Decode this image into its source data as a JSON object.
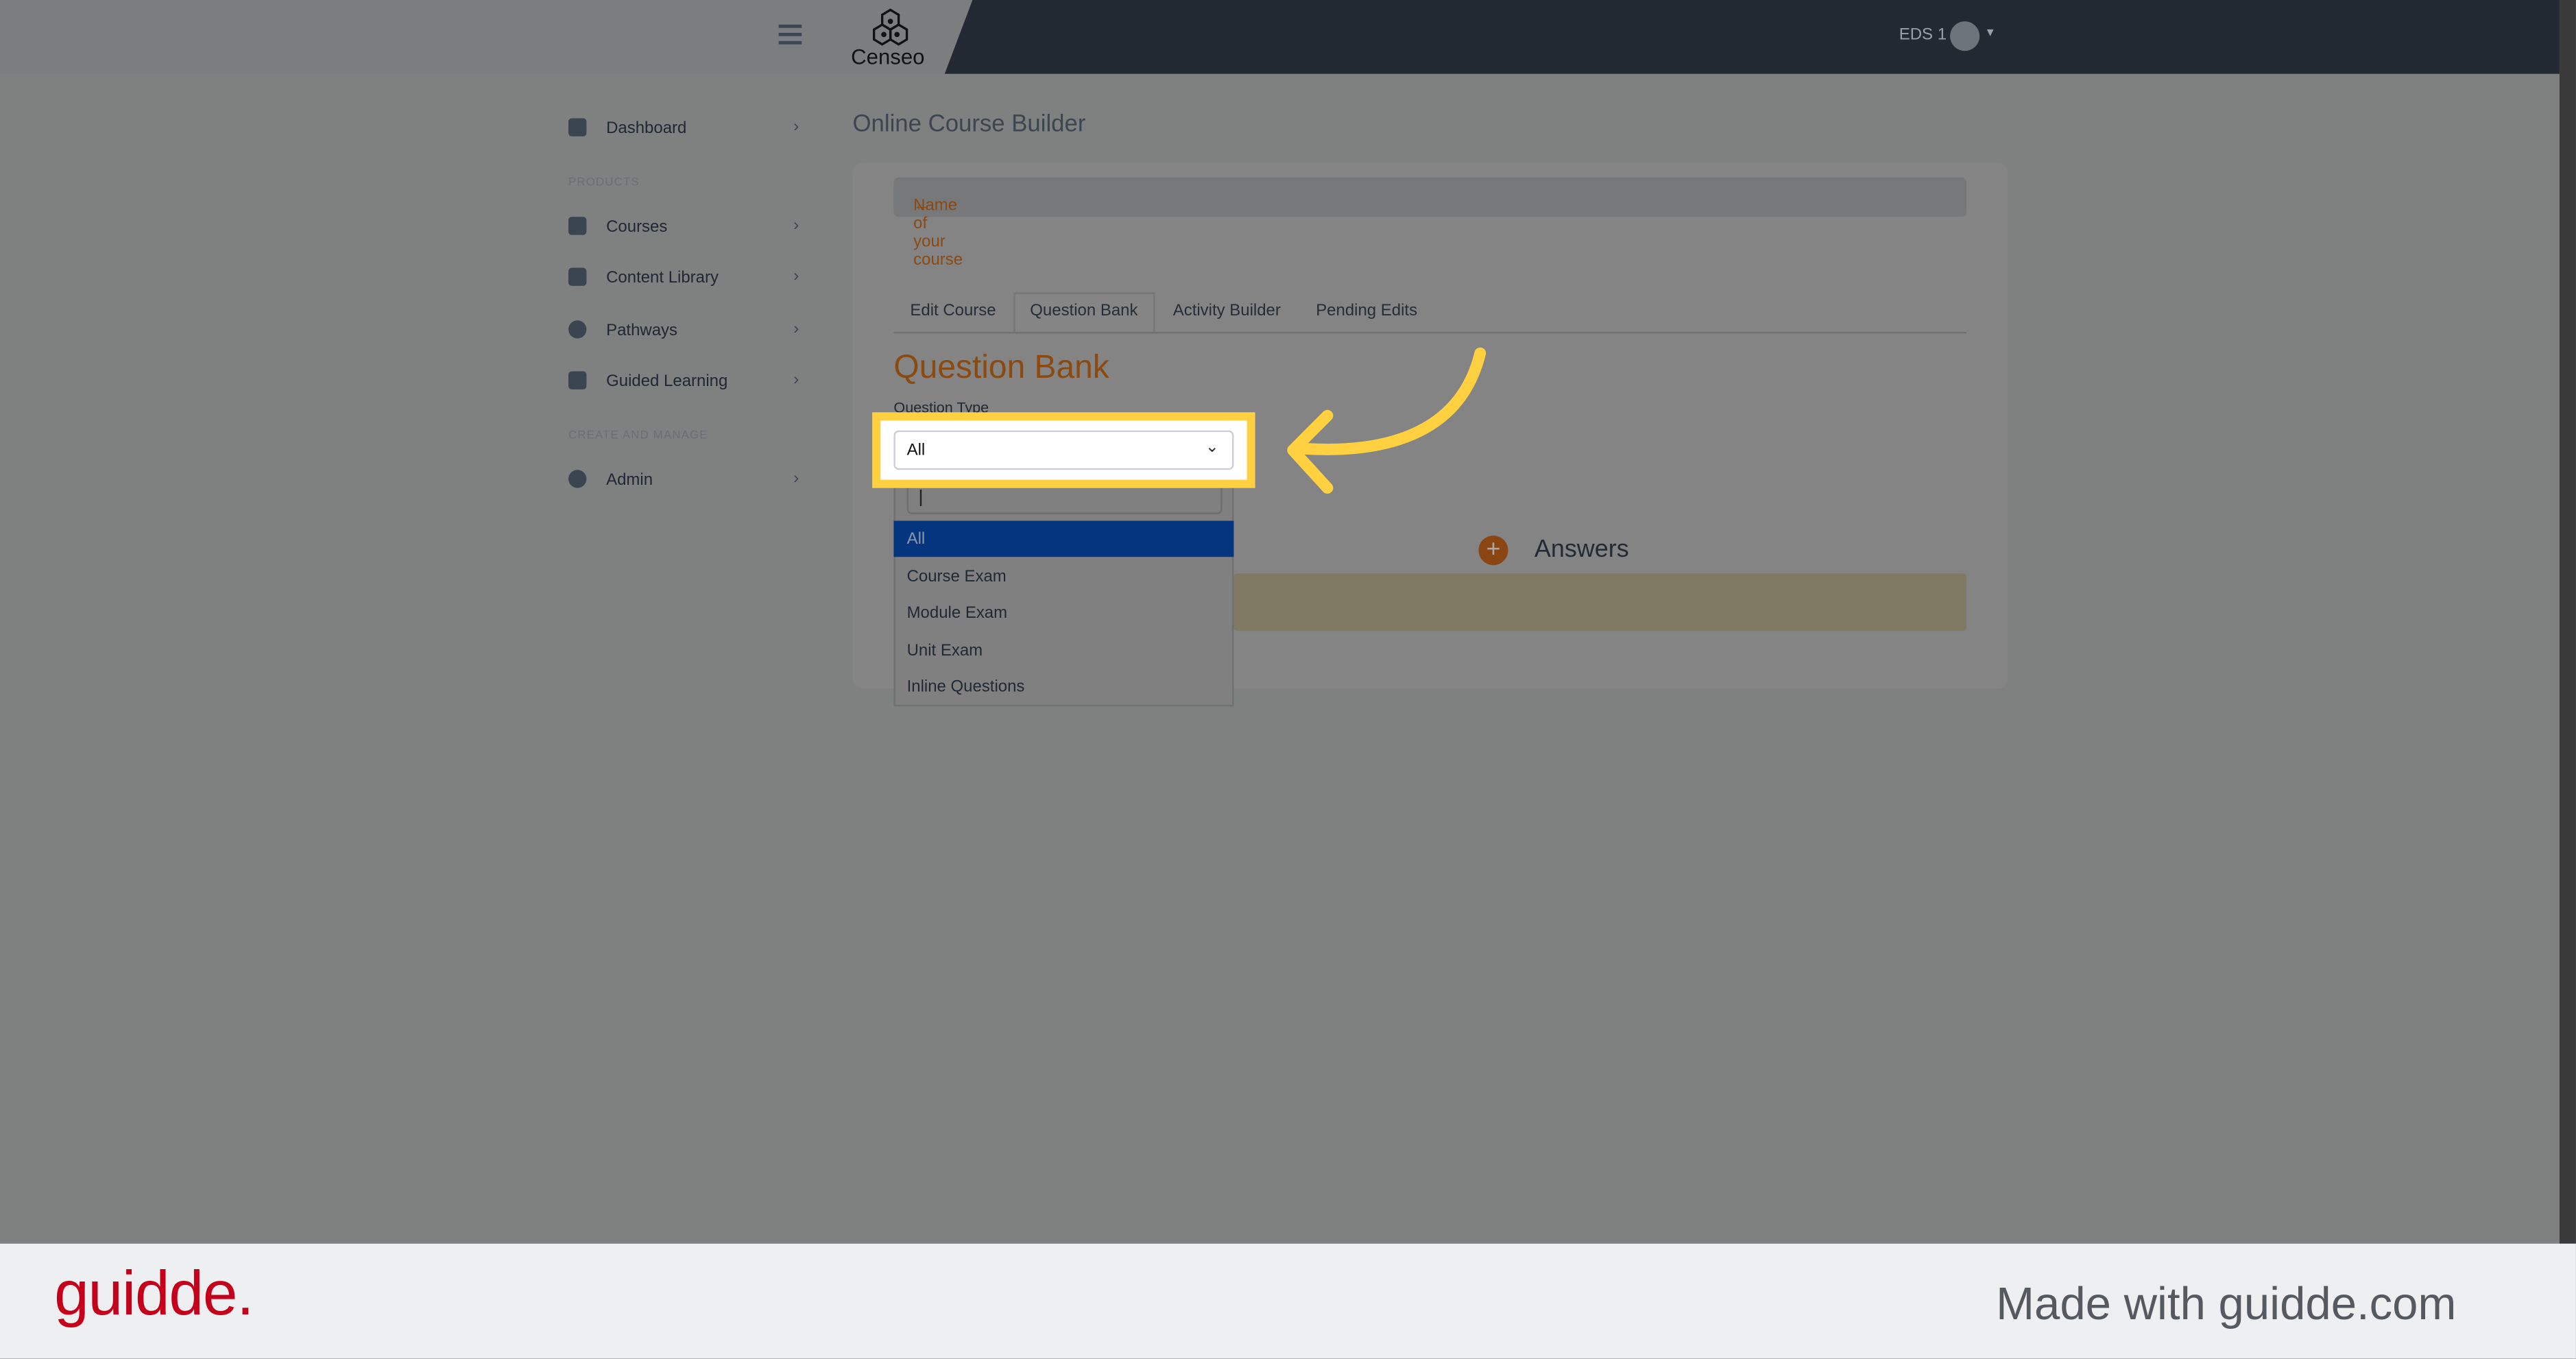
{
  "header": {
    "logo_text": "Censeo",
    "user_label": "EDS 1"
  },
  "sidebar": {
    "items": [
      {
        "label": "Dashboard"
      },
      {
        "label": "Courses"
      },
      {
        "label": "Content Library"
      },
      {
        "label": "Pathways"
      },
      {
        "label": "Guided Learning"
      },
      {
        "label": "Admin"
      }
    ],
    "sections": [
      "PRODUCTS",
      "CREATE AND MANAGE"
    ]
  },
  "main": {
    "page_title": "Online Course Builder",
    "course_link": "Name of your course",
    "tabs": [
      {
        "label": "Edit Course"
      },
      {
        "label": "Question Bank"
      },
      {
        "label": "Activity Builder"
      },
      {
        "label": "Pending Edits"
      }
    ],
    "active_tab": "Question Bank",
    "heading": "Question Bank",
    "question_type_label": "Question Type",
    "select_value": "All",
    "options": [
      "All",
      "Course Exam",
      "Module Exam",
      "Unit Exam",
      "Inline Questions"
    ],
    "answers_label": "Answers"
  },
  "colors": {
    "accent": "#d06a1c",
    "highlight": "#ffd140",
    "selected_option": "#0a4bb5",
    "brand_footer": "#c4001a"
  },
  "footer": {
    "logo": "guidde.",
    "made_with": "Made with guidde.com"
  }
}
